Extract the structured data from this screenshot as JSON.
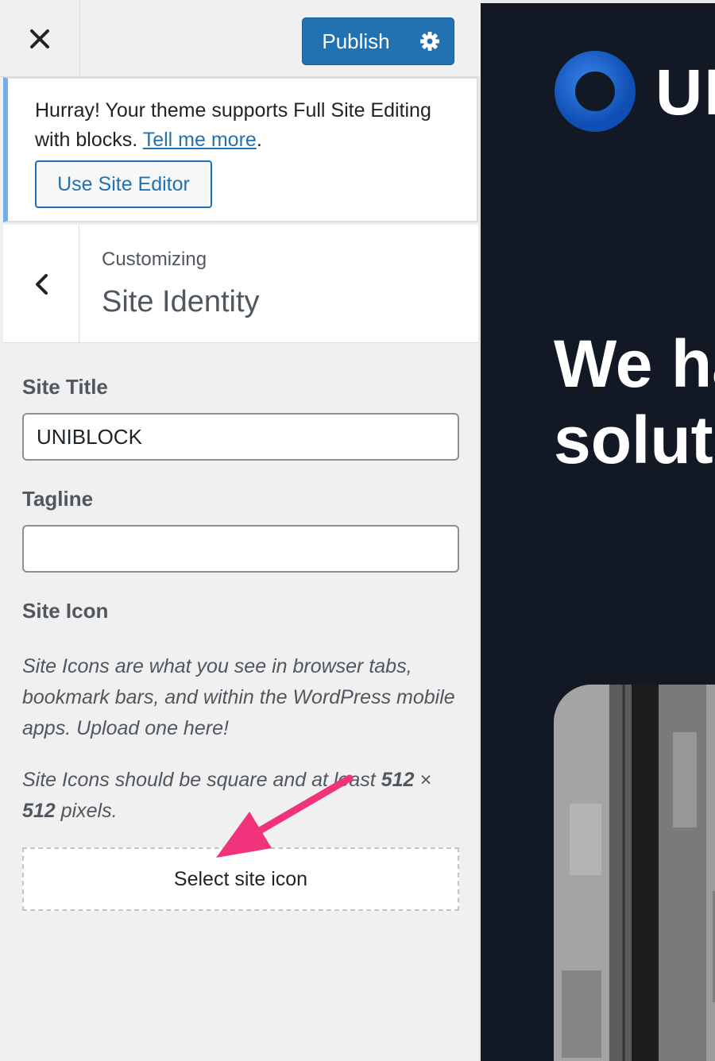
{
  "toolbar": {
    "close_icon": "close-icon",
    "publish_label": "Publish",
    "settings_icon": "gear-icon",
    "accent_color": "#2271b1"
  },
  "notice": {
    "text_before": "Hurray! Your theme supports Full Site Editing with blocks.",
    "link_text": "Tell me more",
    "text_after": ".",
    "button_label": "Use Site Editor"
  },
  "section": {
    "back_icon": "chevron-left-icon",
    "breadcrumb": "Customizing",
    "title": "Site Identity"
  },
  "site_title": {
    "label": "Site Title",
    "value": "UNIBLOCK"
  },
  "tagline": {
    "label": "Tagline",
    "value": ""
  },
  "site_icon": {
    "label": "Site Icon",
    "description": "Site Icons are what you see in browser tabs, bookmark bars, and within the WordPress mobile apps. Upload one here!",
    "size_note_before": "Site Icons should be square and at least ",
    "size_note_bold1": "512",
    "size_note_sep": " × ",
    "size_note_bold2": "512",
    "size_note_after": " pixels.",
    "button_label": "Select site icon",
    "annotation_color": "#f0337a"
  },
  "preview": {
    "logo_text": "UNIBLOCK",
    "hero_line1": "We have",
    "hero_line2": "solutions",
    "background_color": "#121924",
    "logo_color": "#1e62c6"
  }
}
